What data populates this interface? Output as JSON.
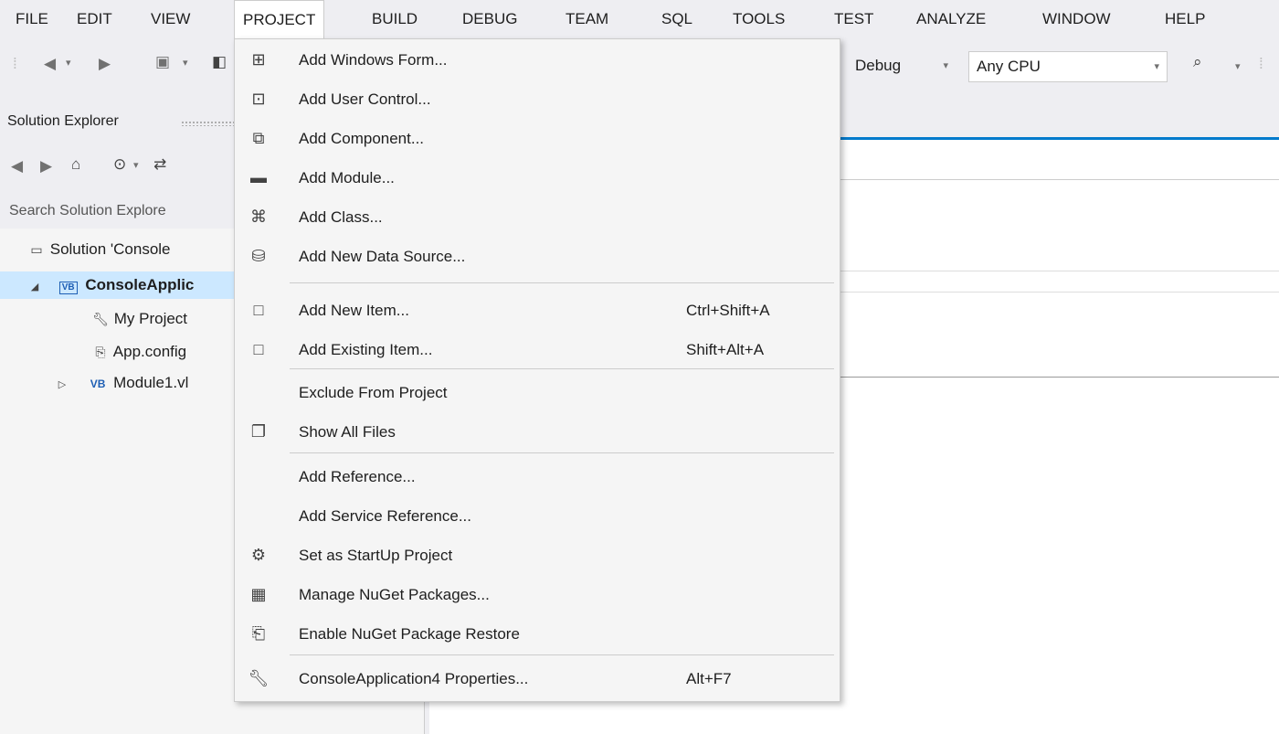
{
  "menubar": {
    "items": [
      "FILE",
      "EDIT",
      "VIEW",
      "PROJECT",
      "BUILD",
      "DEBUG",
      "TEAM",
      "SQL",
      "TOOLS",
      "TEST",
      "ANALYZE",
      "WINDOW",
      "HELP"
    ],
    "active": "PROJECT"
  },
  "toolbar": {
    "config_value": "Debug",
    "platform_value": "Any CPU"
  },
  "solution_explorer": {
    "title": "Solution Explorer",
    "search_placeholder": "Search Solution Explore",
    "tree": [
      {
        "label": "Solution 'Console",
        "icon": "solution-icon"
      },
      {
        "label": "ConsoleApplic",
        "icon": "vb-project-icon"
      },
      {
        "label": "My Project",
        "icon": "wrench-icon"
      },
      {
        "label": "App.config",
        "icon": "config-icon"
      },
      {
        "label": "Module1.vl",
        "icon": "vb-file-icon"
      }
    ]
  },
  "project_menu": {
    "items": [
      {
        "label": "Add Windows Form...",
        "shortcut": "",
        "icon": "add-form-icon"
      },
      {
        "label": "Add User Control...",
        "shortcut": "",
        "icon": "add-user-control-icon"
      },
      {
        "label": "Add Component...",
        "shortcut": "",
        "icon": "add-component-icon"
      },
      {
        "label": "Add Module...",
        "shortcut": "",
        "icon": "add-module-icon"
      },
      {
        "label": "Add Class...",
        "shortcut": "",
        "icon": "add-class-icon"
      },
      {
        "label": "Add New Data Source...",
        "shortcut": "",
        "icon": "add-data-source-icon"
      },
      {
        "label": "Add New Item...",
        "shortcut": "Ctrl+Shift+A",
        "icon": "add-new-item-icon"
      },
      {
        "label": "Add Existing Item...",
        "shortcut": "Shift+Alt+A",
        "icon": "add-existing-item-icon"
      },
      {
        "label": "Exclude From Project",
        "shortcut": "",
        "icon": ""
      },
      {
        "label": "Show All Files",
        "shortcut": "",
        "icon": "show-all-files-icon"
      },
      {
        "label": "Add Reference...",
        "shortcut": "",
        "icon": ""
      },
      {
        "label": "Add Service Reference...",
        "shortcut": "",
        "icon": ""
      },
      {
        "label": "Set as StartUp Project",
        "shortcut": "",
        "icon": "gear-icon"
      },
      {
        "label": "Manage NuGet Packages...",
        "shortcut": "",
        "icon": "nuget-icon"
      },
      {
        "label": "Enable NuGet Package Restore",
        "shortcut": "",
        "icon": "package-restore-icon"
      },
      {
        "label": "ConsoleApplication4 Properties...",
        "shortcut": "Alt+F7",
        "icon": "wrench-icon"
      }
    ]
  }
}
